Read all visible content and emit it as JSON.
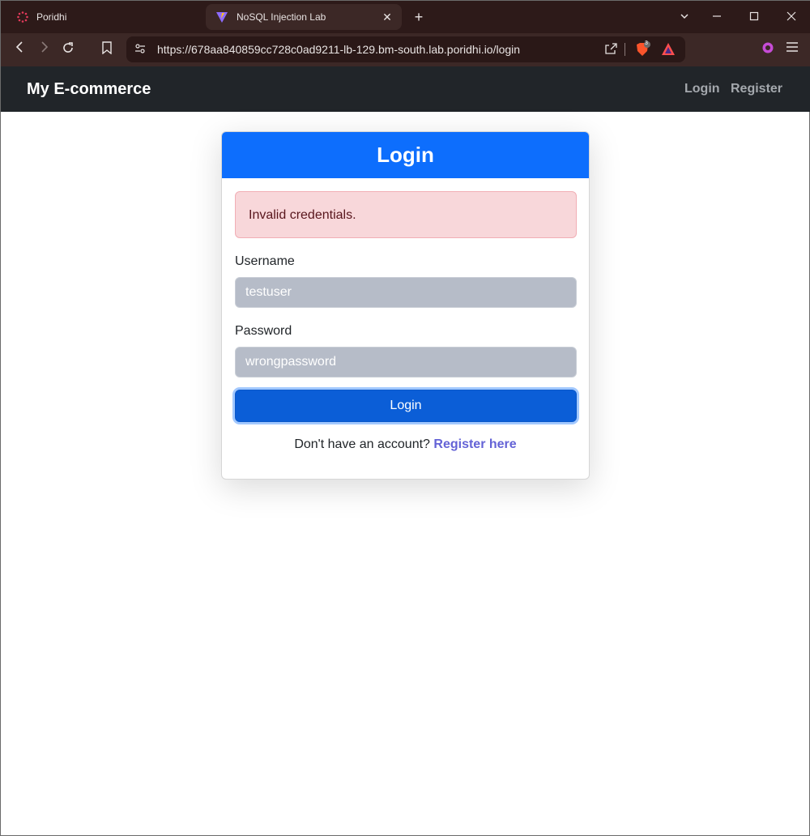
{
  "browser": {
    "tabs": [
      {
        "label": "Poridhi",
        "icon": "poridhi-logo-icon"
      },
      {
        "label": "NoSQL Injection Lab",
        "icon": "vite-logo-icon"
      }
    ],
    "url": "https://678aa840859cc728c0ad9211-lb-129.bm-south.lab.poridhi.io/login",
    "shield_count": "3"
  },
  "navbar": {
    "brand": "My E-commerce",
    "links": [
      {
        "label": "Login"
      },
      {
        "label": "Register"
      }
    ]
  },
  "login_card": {
    "title": "Login",
    "alert": "Invalid credentials.",
    "username_label": "Username",
    "username_value": "testuser",
    "password_label": "Password",
    "password_value": "wrongpassword",
    "submit_label": "Login",
    "footer_text": "Don't have an account?",
    "register_link": "Register here"
  },
  "colors": {
    "primary": "#0d6efd",
    "navbar_bg": "#212529",
    "alert_bg": "#f8d7da",
    "alert_text": "#58151c",
    "link": "#6463d6"
  }
}
